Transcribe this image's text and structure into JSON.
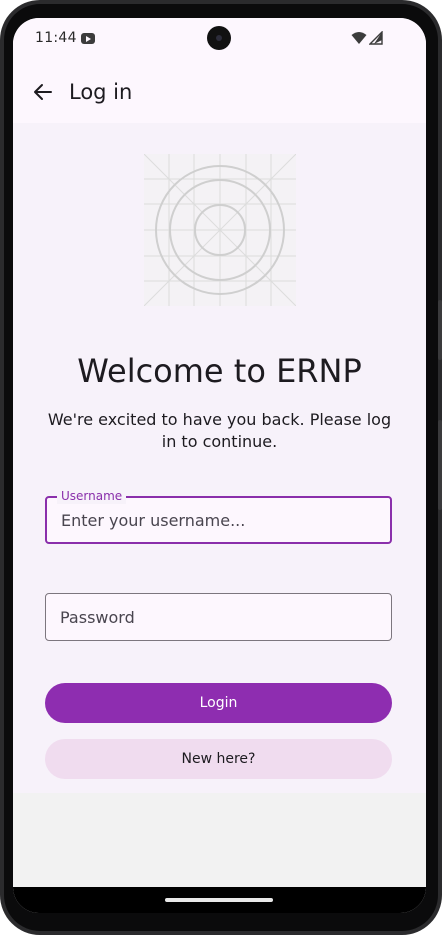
{
  "status_bar": {
    "time": "11:44",
    "icons": [
      "youtube-icon",
      "wifi-icon",
      "signal-icon"
    ]
  },
  "app_bar": {
    "title": "Log in",
    "back_icon": "arrow-back-icon"
  },
  "main": {
    "logo_icon": "placeholder-grid-logo",
    "welcome_title": "Welcome to ERNP",
    "subtitle": "We're excited to have you back. Please log in to continue.",
    "username": {
      "label": "Username",
      "placeholder": "Enter your username...",
      "value": ""
    },
    "password": {
      "placeholder": "Password",
      "value": ""
    },
    "login_button": "Login",
    "new_here_button": "New here?"
  },
  "colors": {
    "primary": "#8e2db0",
    "secondary_button": "#f0dcef",
    "surface": "#f7f2fa",
    "app_bar": "#fdf7fe"
  }
}
